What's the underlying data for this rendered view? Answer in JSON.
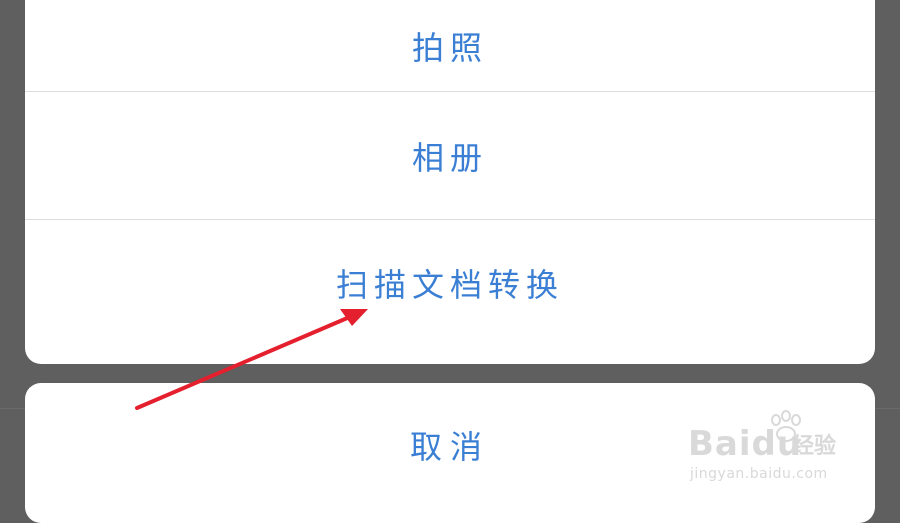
{
  "action_sheet": {
    "items": [
      {
        "label": "拍照"
      },
      {
        "label": "相册"
      },
      {
        "label": "扫描文档转换"
      }
    ],
    "cancel_label": "取消"
  },
  "annotation": {
    "arrow_color": "#e5202e"
  },
  "watermark": {
    "logo_text": "Baidu",
    "cn_text": "经验",
    "url": "jingyan.baidu.com"
  },
  "colors": {
    "accent": "#3b7fd4",
    "overlay": "#5f5f5f",
    "sheet": "#ffffff"
  }
}
